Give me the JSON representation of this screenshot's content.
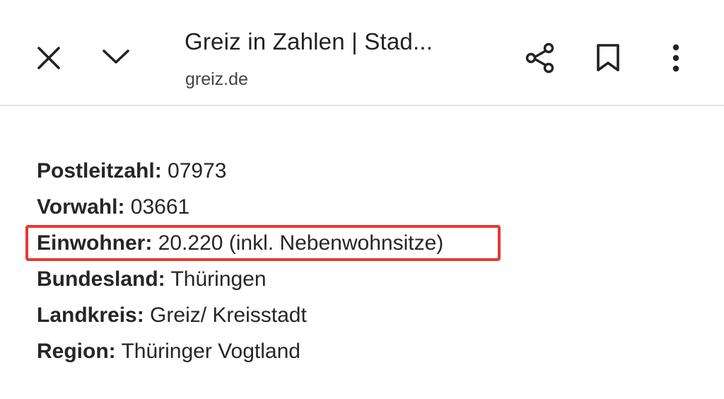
{
  "toolbar": {
    "title": "Greiz in Zahlen | Stad...",
    "url": "greiz.de",
    "icons": {
      "close": "close-icon",
      "collapse": "chevron-down-icon",
      "share": "share-icon",
      "bookmark": "bookmark-icon",
      "menu": "more-vertical-icon"
    }
  },
  "facts": [
    {
      "label": "Postleitzahl:",
      "value": " 07973"
    },
    {
      "label": "Vorwahl:",
      "value": " 03661"
    },
    {
      "label": "Einwohner:",
      "value": " 20.220 (inkl. Nebenwohnsitze)"
    },
    {
      "label": "Bundesland:",
      "value": " Thüringen"
    },
    {
      "label": "Landkreis:",
      "value": " Greiz/ Kreisstadt"
    },
    {
      "label": "Region:",
      "value": " Thüringer Vogtland"
    }
  ],
  "colors": {
    "highlight_border": "#e53935"
  }
}
